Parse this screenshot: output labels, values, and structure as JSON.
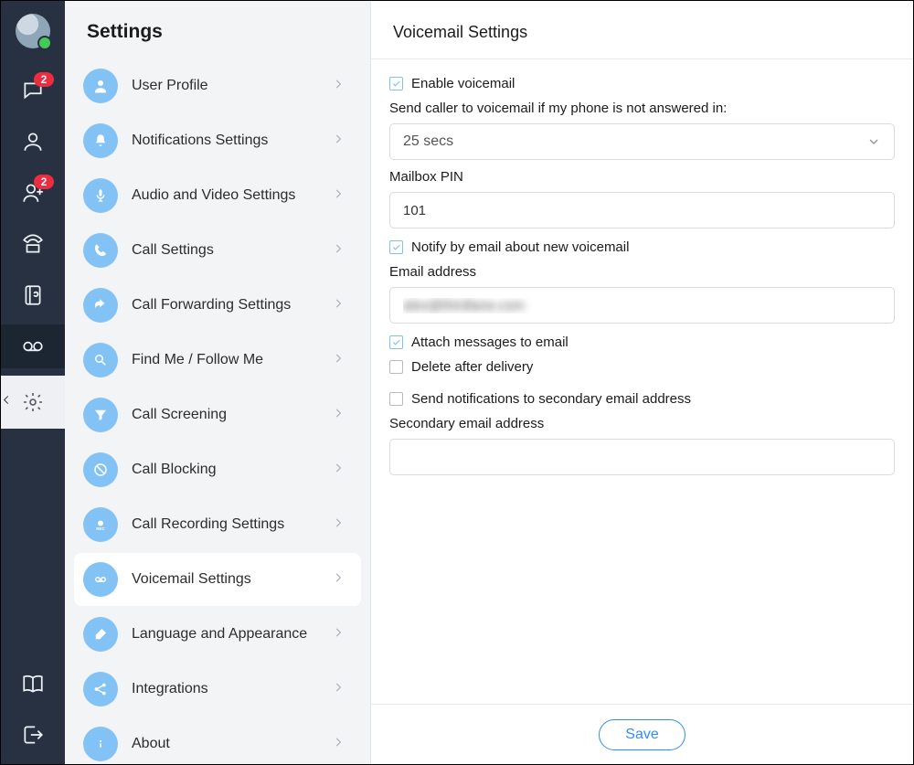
{
  "rail": {
    "chat_badge": "2",
    "contacts_badge": "2"
  },
  "settings": {
    "title": "Settings",
    "items": [
      {
        "label": "User Profile"
      },
      {
        "label": "Notifications Settings"
      },
      {
        "label": "Audio and Video Settings"
      },
      {
        "label": "Call Settings"
      },
      {
        "label": "Call Forwarding Settings"
      },
      {
        "label": "Find Me / Follow Me"
      },
      {
        "label": "Call Screening"
      },
      {
        "label": "Call Blocking"
      },
      {
        "label": "Call Recording Settings"
      },
      {
        "label": "Voicemail Settings"
      },
      {
        "label": "Language and Appearance"
      },
      {
        "label": "Integrations"
      },
      {
        "label": "About"
      }
    ]
  },
  "panel": {
    "title": "Voicemail Settings",
    "enable_voicemail_label": "Enable voicemail",
    "enable_voicemail_checked": true,
    "send_after_label": "Send caller to voicemail if my phone is not answered in:",
    "send_after_value": "25 secs",
    "mailbox_pin_label": "Mailbox PIN",
    "mailbox_pin_value": "101",
    "notify_email_label": "Notify by email about new voicemail",
    "notify_email_checked": true,
    "email_label": "Email address",
    "email_value": "alex@thirdlane.com",
    "attach_label": "Attach messages to email",
    "attach_checked": true,
    "delete_label": "Delete after delivery",
    "delete_checked": false,
    "secondary_notify_label": "Send notifications to secondary email address",
    "secondary_notify_checked": false,
    "secondary_email_label": "Secondary email address",
    "secondary_email_value": "",
    "save_label": "Save"
  }
}
